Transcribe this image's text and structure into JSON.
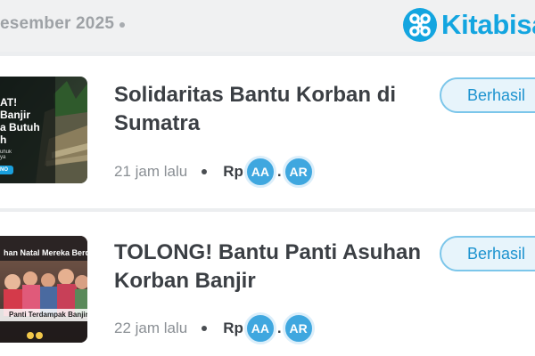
{
  "header": {
    "date_label": "esember 2025",
    "brand": "Kitabisa",
    "brand_color": "#13a5e0"
  },
  "campaigns": [
    {
      "title": "Solidaritas Bantu Korban di Sumatra",
      "time": "21 jam lalu",
      "currency": "Rp",
      "amount_badges": [
        "AA",
        "AR"
      ],
      "amount_separator": ".",
      "status": "Berhasil",
      "thumbnail_text": [
        "AT!",
        "Banjir",
        "a Butuh",
        "h"
      ],
      "thumbnail_small_text": "uhuk\nya",
      "thumbnail_button": "NO"
    },
    {
      "title": "TOLONG! Bantu Panti Asuhan Korban Banjir",
      "time": "22 jam lalu",
      "currency": "Rp",
      "amount_badges": [
        "AA",
        "AR"
      ],
      "amount_separator": ".",
      "status": "Berhasil",
      "thumbnail_text": [
        "han Natal Mereka Berduk",
        "Panti Terdampak Banjir"
      ],
      "thumbnail_small_text": "",
      "thumbnail_button": ""
    }
  ]
}
